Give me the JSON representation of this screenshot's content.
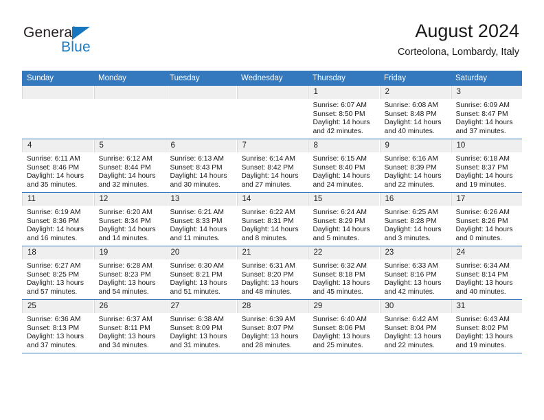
{
  "brand": {
    "name_part1": "General",
    "name_part2": "Blue",
    "triangle_color": "#1676c0",
    "blue_color": "#1b7bc4"
  },
  "header": {
    "title": "August 2024",
    "subtitle": "Corteolona, Lombardy, Italy"
  },
  "theme": {
    "header_row_bg": "#3479bd",
    "header_row_text": "#ffffff",
    "daynum_bg": "#efefef",
    "cell_bg": "#ffffff",
    "rule_color": "#3479bd"
  },
  "weekday_headers": [
    "Sunday",
    "Monday",
    "Tuesday",
    "Wednesday",
    "Thursday",
    "Friday",
    "Saturday"
  ],
  "weeks": [
    [
      {
        "day": "",
        "sunrise": "",
        "sunset": "",
        "daylight_line1": "",
        "daylight_line2": ""
      },
      {
        "day": "",
        "sunrise": "",
        "sunset": "",
        "daylight_line1": "",
        "daylight_line2": ""
      },
      {
        "day": "",
        "sunrise": "",
        "sunset": "",
        "daylight_line1": "",
        "daylight_line2": ""
      },
      {
        "day": "",
        "sunrise": "",
        "sunset": "",
        "daylight_line1": "",
        "daylight_line2": ""
      },
      {
        "day": "1",
        "sunrise": "Sunrise: 6:07 AM",
        "sunset": "Sunset: 8:50 PM",
        "daylight_line1": "Daylight: 14 hours",
        "daylight_line2": "and 42 minutes."
      },
      {
        "day": "2",
        "sunrise": "Sunrise: 6:08 AM",
        "sunset": "Sunset: 8:48 PM",
        "daylight_line1": "Daylight: 14 hours",
        "daylight_line2": "and 40 minutes."
      },
      {
        "day": "3",
        "sunrise": "Sunrise: 6:09 AM",
        "sunset": "Sunset: 8:47 PM",
        "daylight_line1": "Daylight: 14 hours",
        "daylight_line2": "and 37 minutes."
      }
    ],
    [
      {
        "day": "4",
        "sunrise": "Sunrise: 6:11 AM",
        "sunset": "Sunset: 8:46 PM",
        "daylight_line1": "Daylight: 14 hours",
        "daylight_line2": "and 35 minutes."
      },
      {
        "day": "5",
        "sunrise": "Sunrise: 6:12 AM",
        "sunset": "Sunset: 8:44 PM",
        "daylight_line1": "Daylight: 14 hours",
        "daylight_line2": "and 32 minutes."
      },
      {
        "day": "6",
        "sunrise": "Sunrise: 6:13 AM",
        "sunset": "Sunset: 8:43 PM",
        "daylight_line1": "Daylight: 14 hours",
        "daylight_line2": "and 30 minutes."
      },
      {
        "day": "7",
        "sunrise": "Sunrise: 6:14 AM",
        "sunset": "Sunset: 8:42 PM",
        "daylight_line1": "Daylight: 14 hours",
        "daylight_line2": "and 27 minutes."
      },
      {
        "day": "8",
        "sunrise": "Sunrise: 6:15 AM",
        "sunset": "Sunset: 8:40 PM",
        "daylight_line1": "Daylight: 14 hours",
        "daylight_line2": "and 24 minutes."
      },
      {
        "day": "9",
        "sunrise": "Sunrise: 6:16 AM",
        "sunset": "Sunset: 8:39 PM",
        "daylight_line1": "Daylight: 14 hours",
        "daylight_line2": "and 22 minutes."
      },
      {
        "day": "10",
        "sunrise": "Sunrise: 6:18 AM",
        "sunset": "Sunset: 8:37 PM",
        "daylight_line1": "Daylight: 14 hours",
        "daylight_line2": "and 19 minutes."
      }
    ],
    [
      {
        "day": "11",
        "sunrise": "Sunrise: 6:19 AM",
        "sunset": "Sunset: 8:36 PM",
        "daylight_line1": "Daylight: 14 hours",
        "daylight_line2": "and 16 minutes."
      },
      {
        "day": "12",
        "sunrise": "Sunrise: 6:20 AM",
        "sunset": "Sunset: 8:34 PM",
        "daylight_line1": "Daylight: 14 hours",
        "daylight_line2": "and 14 minutes."
      },
      {
        "day": "13",
        "sunrise": "Sunrise: 6:21 AM",
        "sunset": "Sunset: 8:33 PM",
        "daylight_line1": "Daylight: 14 hours",
        "daylight_line2": "and 11 minutes."
      },
      {
        "day": "14",
        "sunrise": "Sunrise: 6:22 AM",
        "sunset": "Sunset: 8:31 PM",
        "daylight_line1": "Daylight: 14 hours",
        "daylight_line2": "and 8 minutes."
      },
      {
        "day": "15",
        "sunrise": "Sunrise: 6:24 AM",
        "sunset": "Sunset: 8:29 PM",
        "daylight_line1": "Daylight: 14 hours",
        "daylight_line2": "and 5 minutes."
      },
      {
        "day": "16",
        "sunrise": "Sunrise: 6:25 AM",
        "sunset": "Sunset: 8:28 PM",
        "daylight_line1": "Daylight: 14 hours",
        "daylight_line2": "and 3 minutes."
      },
      {
        "day": "17",
        "sunrise": "Sunrise: 6:26 AM",
        "sunset": "Sunset: 8:26 PM",
        "daylight_line1": "Daylight: 14 hours",
        "daylight_line2": "and 0 minutes."
      }
    ],
    [
      {
        "day": "18",
        "sunrise": "Sunrise: 6:27 AM",
        "sunset": "Sunset: 8:25 PM",
        "daylight_line1": "Daylight: 13 hours",
        "daylight_line2": "and 57 minutes."
      },
      {
        "day": "19",
        "sunrise": "Sunrise: 6:28 AM",
        "sunset": "Sunset: 8:23 PM",
        "daylight_line1": "Daylight: 13 hours",
        "daylight_line2": "and 54 minutes."
      },
      {
        "day": "20",
        "sunrise": "Sunrise: 6:30 AM",
        "sunset": "Sunset: 8:21 PM",
        "daylight_line1": "Daylight: 13 hours",
        "daylight_line2": "and 51 minutes."
      },
      {
        "day": "21",
        "sunrise": "Sunrise: 6:31 AM",
        "sunset": "Sunset: 8:20 PM",
        "daylight_line1": "Daylight: 13 hours",
        "daylight_line2": "and 48 minutes."
      },
      {
        "day": "22",
        "sunrise": "Sunrise: 6:32 AM",
        "sunset": "Sunset: 8:18 PM",
        "daylight_line1": "Daylight: 13 hours",
        "daylight_line2": "and 45 minutes."
      },
      {
        "day": "23",
        "sunrise": "Sunrise: 6:33 AM",
        "sunset": "Sunset: 8:16 PM",
        "daylight_line1": "Daylight: 13 hours",
        "daylight_line2": "and 42 minutes."
      },
      {
        "day": "24",
        "sunrise": "Sunrise: 6:34 AM",
        "sunset": "Sunset: 8:14 PM",
        "daylight_line1": "Daylight: 13 hours",
        "daylight_line2": "and 40 minutes."
      }
    ],
    [
      {
        "day": "25",
        "sunrise": "Sunrise: 6:36 AM",
        "sunset": "Sunset: 8:13 PM",
        "daylight_line1": "Daylight: 13 hours",
        "daylight_line2": "and 37 minutes."
      },
      {
        "day": "26",
        "sunrise": "Sunrise: 6:37 AM",
        "sunset": "Sunset: 8:11 PM",
        "daylight_line1": "Daylight: 13 hours",
        "daylight_line2": "and 34 minutes."
      },
      {
        "day": "27",
        "sunrise": "Sunrise: 6:38 AM",
        "sunset": "Sunset: 8:09 PM",
        "daylight_line1": "Daylight: 13 hours",
        "daylight_line2": "and 31 minutes."
      },
      {
        "day": "28",
        "sunrise": "Sunrise: 6:39 AM",
        "sunset": "Sunset: 8:07 PM",
        "daylight_line1": "Daylight: 13 hours",
        "daylight_line2": "and 28 minutes."
      },
      {
        "day": "29",
        "sunrise": "Sunrise: 6:40 AM",
        "sunset": "Sunset: 8:06 PM",
        "daylight_line1": "Daylight: 13 hours",
        "daylight_line2": "and 25 minutes."
      },
      {
        "day": "30",
        "sunrise": "Sunrise: 6:42 AM",
        "sunset": "Sunset: 8:04 PM",
        "daylight_line1": "Daylight: 13 hours",
        "daylight_line2": "and 22 minutes."
      },
      {
        "day": "31",
        "sunrise": "Sunrise: 6:43 AM",
        "sunset": "Sunset: 8:02 PM",
        "daylight_line1": "Daylight: 13 hours",
        "daylight_line2": "and 19 minutes."
      }
    ]
  ]
}
